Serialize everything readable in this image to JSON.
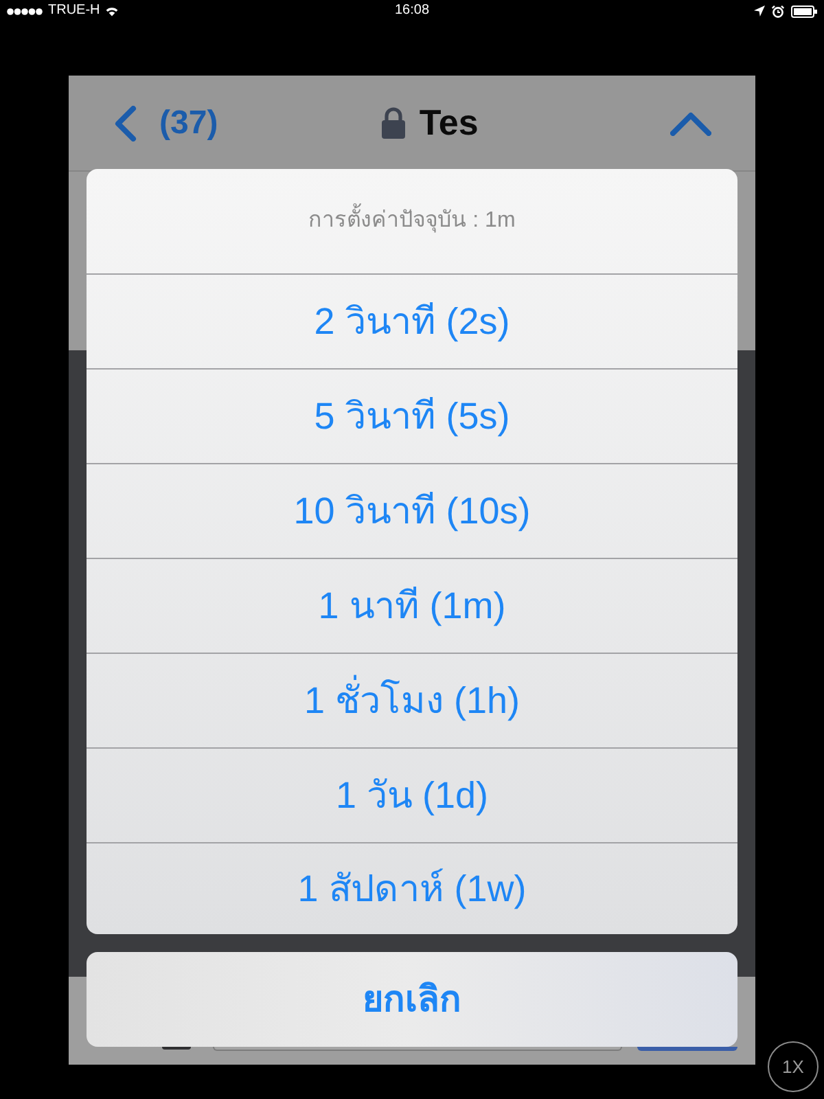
{
  "status_bar": {
    "carrier": "TRUE-H",
    "time": "16:08"
  },
  "nav_bar": {
    "back_count": "(37)",
    "title": "Tes"
  },
  "action_sheet": {
    "header": "การตั้งค่าปัจจุบัน : 1m",
    "options": [
      "2 วินาที (2s)",
      "5 วินาที (5s)",
      "10 วินาที (10s)",
      "1 นาที (1m)",
      "1 ชั่วโมง (1h)",
      "1 วัน (1d)",
      "1 สัปดาห์ (1w)"
    ],
    "cancel": "ยกเลิก"
  },
  "zoom_button": {
    "label": "1X"
  }
}
